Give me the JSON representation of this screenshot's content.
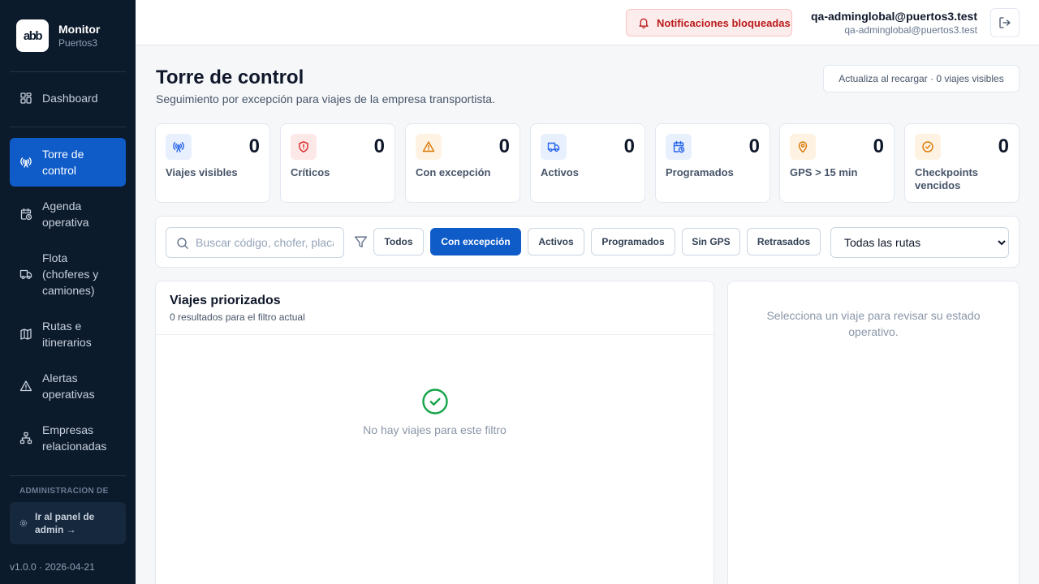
{
  "sidebar": {
    "app_title": "Monitor",
    "app_subtitle": "Puertos3",
    "logo_text": "abb",
    "items": [
      {
        "label": "Dashboard",
        "icon": "dashboard-icon"
      },
      {
        "label": "Torre de control",
        "icon": "radio-tower-icon",
        "active": true
      },
      {
        "label": "Agenda operativa",
        "icon": "calendar-clock-icon"
      },
      {
        "label": "Flota (choferes y camiones)",
        "icon": "truck-icon"
      },
      {
        "label": "Rutas e itinerarios",
        "icon": "map-icon"
      },
      {
        "label": "Alertas operativas",
        "icon": "alert-triangle-icon"
      },
      {
        "label": "Empresas relacionadas",
        "icon": "network-icon"
      }
    ],
    "admin_section_label": "ADMINISTRACIÓN DE EMPRESA",
    "admin_button_label": "Ir al panel de admin →",
    "version": "v1.0.0 · 2026-04-21"
  },
  "topbar": {
    "notification_label": "Notificaciones bloqueadas",
    "user_name": "qa-adminglobal@puertos3.test",
    "user_email": "qa-adminglobal@puertos3.test"
  },
  "page": {
    "title": "Torre de control",
    "subtitle": "Seguimiento por excepción para viajes de la empresa transportista.",
    "refresh_info": "Actualiza al recargar · 0 viajes visibles"
  },
  "stats": [
    {
      "label": "Viajes visibles",
      "value": "0",
      "icon": "radio-tower-icon",
      "color": "#2563eb",
      "bg": "#e8f0fe"
    },
    {
      "label": "Críticos",
      "value": "0",
      "icon": "shield-alert-icon",
      "color": "#dc2626",
      "bg": "#fde8e8"
    },
    {
      "label": "Con excepción",
      "value": "0",
      "icon": "alert-triangle-icon",
      "color": "#d97706",
      "bg": "#fef3e2"
    },
    {
      "label": "Activos",
      "value": "0",
      "icon": "truck-icon",
      "color": "#2563eb",
      "bg": "#e8f0fe"
    },
    {
      "label": "Programados",
      "value": "0",
      "icon": "calendar-clock-icon",
      "color": "#2563eb",
      "bg": "#e8f0fe"
    },
    {
      "label": "GPS > 15 min",
      "value": "0",
      "icon": "map-pin-icon",
      "color": "#d97706",
      "bg": "#fef3e2"
    },
    {
      "label": "Checkpoints vencidos",
      "value": "0",
      "icon": "check-circle-icon",
      "color": "#d97706",
      "bg": "#fef3e2"
    }
  ],
  "filters": {
    "search_placeholder": "Buscar código, chofer, placa",
    "chips": [
      "Todos",
      "Con excepción",
      "Activos",
      "Programados",
      "Sin GPS",
      "Retrasados"
    ],
    "active_chip": "Con excepción",
    "route_selected": "Todas las rutas"
  },
  "trips_panel": {
    "title": "Viajes priorizados",
    "subtitle": "0 resultados para el filtro actual",
    "empty_message": "No hay viajes para este filtro"
  },
  "detail_panel": {
    "hint": "Selecciona un viaje para revisar su estado operativo."
  },
  "colors": {
    "sidebar_bg": "#0c1b2c",
    "accent": "#0f5cc9",
    "success": "#16a34a",
    "danger": "#b91c1c"
  }
}
